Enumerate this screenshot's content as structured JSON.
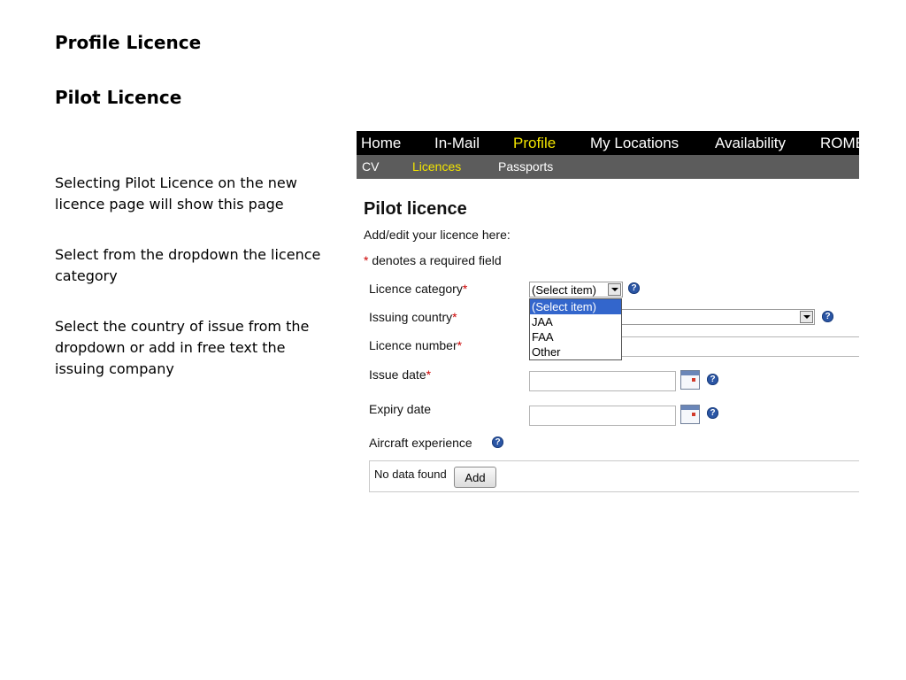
{
  "slide": {
    "title": "Profile Licence",
    "subtitle": "Pilot Licence",
    "notes": [
      "Selecting Pilot Licence on the new licence page will show this page",
      "Select from the dropdown the licence category",
      "Select the country of issue from the dropdown or add in free text the issuing company"
    ]
  },
  "app": {
    "topnav": [
      "Home",
      "In-Mail",
      "Profile",
      "My Locations",
      "Availability",
      "ROME"
    ],
    "topnav_active": "Profile",
    "subnav": [
      "CV",
      "Licences",
      "Passports"
    ],
    "subnav_active": "Licences",
    "heading": "Pilot licence",
    "subtitle": "Add/edit your licence here:",
    "required_star": "*",
    "required_note": " denotes a required field",
    "fields": {
      "licence_category": {
        "label": "Licence category",
        "value": "(Select item)"
      },
      "issuing_country": {
        "label": "Issuing country",
        "value": ""
      },
      "licence_number": {
        "label": "Licence number",
        "value": ""
      },
      "issue_date": {
        "label": "Issue date",
        "value": ""
      },
      "expiry_date": {
        "label": "Expiry date",
        "value": ""
      },
      "aircraft_experience": {
        "label": "Aircraft experience"
      }
    },
    "category_options": [
      "(Select item)",
      "JAA",
      "FAA",
      "Other"
    ],
    "help_glyph": "?",
    "no_data_text": "No data found",
    "add_label": "Add",
    "colors": {
      "active_nav": "#f2e400",
      "required": "#cc0000",
      "selected_option": "#3366cc",
      "help_icon": "#2b56a5"
    },
    "icons": [
      "help-icon",
      "calendar-icon",
      "dropdown-arrow-icon"
    ]
  }
}
